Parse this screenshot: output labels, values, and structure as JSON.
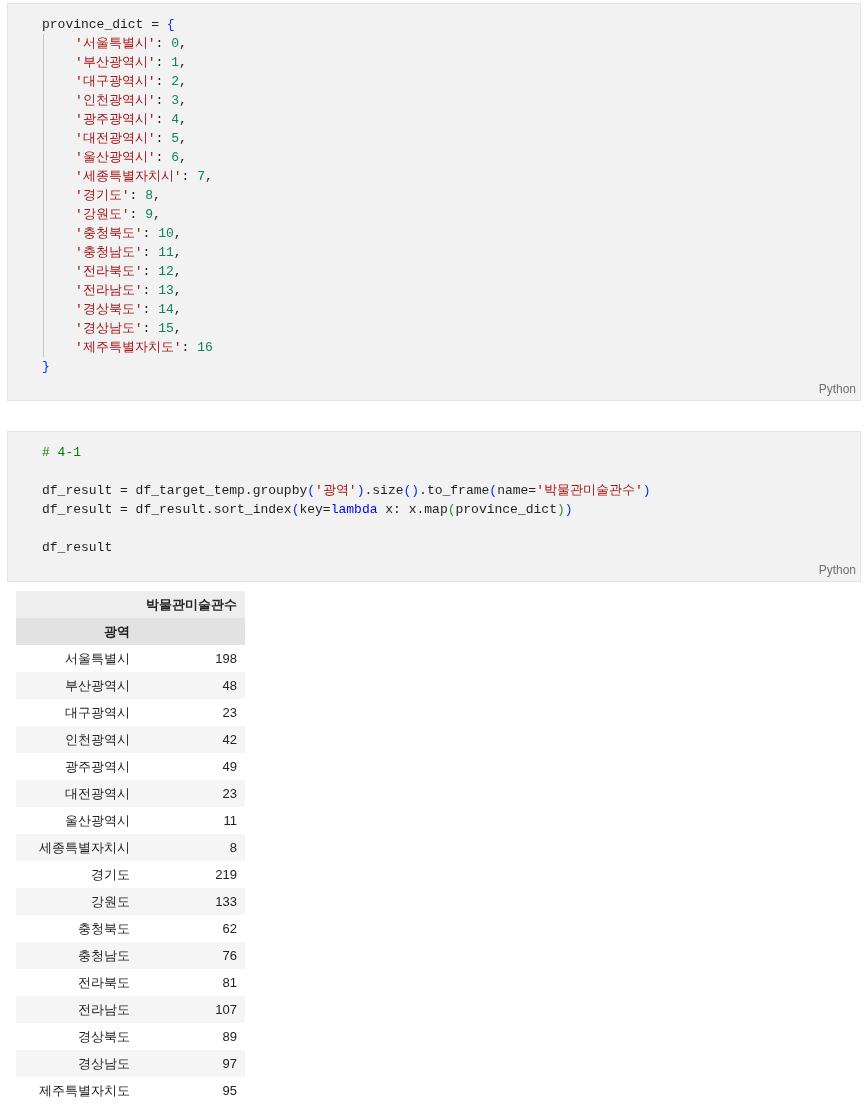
{
  "cells": [
    {
      "lines": [
        {
          "tokens": [
            {
              "kind": "plain",
              "text": "province_dict = "
            },
            {
              "kind": "bracket",
              "text": "{"
            }
          ],
          "children": [
            {
              "tokens": [
                {
                  "kind": "string",
                  "text": "'서울특별시'"
                },
                {
                  "kind": "plain",
                  "text": ": "
                },
                {
                  "kind": "number",
                  "text": "0"
                },
                {
                  "kind": "plain",
                  "text": ","
                }
              ]
            },
            {
              "tokens": [
                {
                  "kind": "string",
                  "text": "'부산광역시'"
                },
                {
                  "kind": "plain",
                  "text": ": "
                },
                {
                  "kind": "number",
                  "text": "1"
                },
                {
                  "kind": "plain",
                  "text": ","
                }
              ]
            },
            {
              "tokens": [
                {
                  "kind": "string",
                  "text": "'대구광역시'"
                },
                {
                  "kind": "plain",
                  "text": ": "
                },
                {
                  "kind": "number",
                  "text": "2"
                },
                {
                  "kind": "plain",
                  "text": ","
                }
              ]
            },
            {
              "tokens": [
                {
                  "kind": "string",
                  "text": "'인천광역시'"
                },
                {
                  "kind": "plain",
                  "text": ": "
                },
                {
                  "kind": "number",
                  "text": "3"
                },
                {
                  "kind": "plain",
                  "text": ","
                }
              ]
            },
            {
              "tokens": [
                {
                  "kind": "string",
                  "text": "'광주광역시'"
                },
                {
                  "kind": "plain",
                  "text": ": "
                },
                {
                  "kind": "number",
                  "text": "4"
                },
                {
                  "kind": "plain",
                  "text": ","
                }
              ]
            },
            {
              "tokens": [
                {
                  "kind": "string",
                  "text": "'대전광역시'"
                },
                {
                  "kind": "plain",
                  "text": ": "
                },
                {
                  "kind": "number",
                  "text": "5"
                },
                {
                  "kind": "plain",
                  "text": ","
                }
              ]
            },
            {
              "tokens": [
                {
                  "kind": "string",
                  "text": "'울산광역시'"
                },
                {
                  "kind": "plain",
                  "text": ": "
                },
                {
                  "kind": "number",
                  "text": "6"
                },
                {
                  "kind": "plain",
                  "text": ","
                }
              ]
            },
            {
              "tokens": [
                {
                  "kind": "string",
                  "text": "'세종특별자치시'"
                },
                {
                  "kind": "plain",
                  "text": ": "
                },
                {
                  "kind": "number",
                  "text": "7"
                },
                {
                  "kind": "plain",
                  "text": ","
                }
              ]
            },
            {
              "tokens": [
                {
                  "kind": "string",
                  "text": "'경기도'"
                },
                {
                  "kind": "plain",
                  "text": ": "
                },
                {
                  "kind": "number",
                  "text": "8"
                },
                {
                  "kind": "plain",
                  "text": ","
                }
              ]
            },
            {
              "tokens": [
                {
                  "kind": "string",
                  "text": "'강원도'"
                },
                {
                  "kind": "plain",
                  "text": ": "
                },
                {
                  "kind": "number",
                  "text": "9"
                },
                {
                  "kind": "plain",
                  "text": ","
                }
              ]
            },
            {
              "tokens": [
                {
                  "kind": "string",
                  "text": "'충청북도'"
                },
                {
                  "kind": "plain",
                  "text": ": "
                },
                {
                  "kind": "number",
                  "text": "10"
                },
                {
                  "kind": "plain",
                  "text": ","
                }
              ]
            },
            {
              "tokens": [
                {
                  "kind": "string",
                  "text": "'충청남도'"
                },
                {
                  "kind": "plain",
                  "text": ": "
                },
                {
                  "kind": "number",
                  "text": "11"
                },
                {
                  "kind": "plain",
                  "text": ","
                }
              ]
            },
            {
              "tokens": [
                {
                  "kind": "string",
                  "text": "'전라북도'"
                },
                {
                  "kind": "plain",
                  "text": ": "
                },
                {
                  "kind": "number",
                  "text": "12"
                },
                {
                  "kind": "plain",
                  "text": ","
                }
              ]
            },
            {
              "tokens": [
                {
                  "kind": "string",
                  "text": "'전라남도'"
                },
                {
                  "kind": "plain",
                  "text": ": "
                },
                {
                  "kind": "number",
                  "text": "13"
                },
                {
                  "kind": "plain",
                  "text": ","
                }
              ]
            },
            {
              "tokens": [
                {
                  "kind": "string",
                  "text": "'경상북도'"
                },
                {
                  "kind": "plain",
                  "text": ": "
                },
                {
                  "kind": "number",
                  "text": "14"
                },
                {
                  "kind": "plain",
                  "text": ","
                }
              ]
            },
            {
              "tokens": [
                {
                  "kind": "string",
                  "text": "'경상남도'"
                },
                {
                  "kind": "plain",
                  "text": ": "
                },
                {
                  "kind": "number",
                  "text": "15"
                },
                {
                  "kind": "plain",
                  "text": ","
                }
              ]
            },
            {
              "tokens": [
                {
                  "kind": "string",
                  "text": "'제주특별자치도'"
                },
                {
                  "kind": "plain",
                  "text": ": "
                },
                {
                  "kind": "number",
                  "text": "16"
                }
              ]
            }
          ]
        },
        {
          "tokens": [
            {
              "kind": "bracket",
              "text": "}"
            }
          ]
        }
      ],
      "language": "Python"
    },
    {
      "lines": [
        {
          "tokens": [
            {
              "kind": "comment",
              "text": "# 4-1"
            }
          ]
        },
        {
          "kind": "blank"
        },
        {
          "tokens": [
            {
              "kind": "plain",
              "text": "df_result = df_target_temp.groupby"
            },
            {
              "kind": "bracket",
              "text": "("
            },
            {
              "kind": "string",
              "text": "'광역'"
            },
            {
              "kind": "bracket",
              "text": ")"
            },
            {
              "kind": "plain",
              "text": ".size"
            },
            {
              "kind": "bracket",
              "text": "()"
            },
            {
              "kind": "plain",
              "text": ".to_frame"
            },
            {
              "kind": "bracket",
              "text": "("
            },
            {
              "kind": "plain",
              "text": "name="
            },
            {
              "kind": "string",
              "text": "'박물관미술관수'"
            },
            {
              "kind": "bracket",
              "text": ")"
            }
          ]
        },
        {
          "tokens": [
            {
              "kind": "plain",
              "text": "df_result = df_result.sort_index"
            },
            {
              "kind": "bracket",
              "text": "("
            },
            {
              "kind": "plain",
              "text": "key="
            },
            {
              "kind": "keyword",
              "text": "lambda"
            },
            {
              "kind": "plain",
              "text": " x: x.map"
            },
            {
              "kind": "nested",
              "text": "("
            },
            {
              "kind": "plain",
              "text": "province_dict"
            },
            {
              "kind": "nested",
              "text": ")"
            },
            {
              "kind": "bracket",
              "text": ")"
            }
          ]
        },
        {
          "kind": "blank"
        },
        {
          "tokens": [
            {
              "kind": "plain",
              "text": "df_result"
            }
          ]
        }
      ],
      "language": "Python"
    }
  ],
  "output_table": {
    "column_header": "박물관미술관수",
    "index_name": "광역",
    "rows": [
      {
        "index": "서울특별시",
        "value": "198"
      },
      {
        "index": "부산광역시",
        "value": "48"
      },
      {
        "index": "대구광역시",
        "value": "23"
      },
      {
        "index": "인천광역시",
        "value": "42"
      },
      {
        "index": "광주광역시",
        "value": "49"
      },
      {
        "index": "대전광역시",
        "value": "23"
      },
      {
        "index": "울산광역시",
        "value": "11"
      },
      {
        "index": "세종특별자치시",
        "value": "8"
      },
      {
        "index": "경기도",
        "value": "219"
      },
      {
        "index": "강원도",
        "value": "133"
      },
      {
        "index": "충청북도",
        "value": "62"
      },
      {
        "index": "충청남도",
        "value": "76"
      },
      {
        "index": "전라북도",
        "value": "81"
      },
      {
        "index": "전라남도",
        "value": "107"
      },
      {
        "index": "경상북도",
        "value": "89"
      },
      {
        "index": "경상남도",
        "value": "97"
      },
      {
        "index": "제주특별자치도",
        "value": "95"
      }
    ]
  }
}
